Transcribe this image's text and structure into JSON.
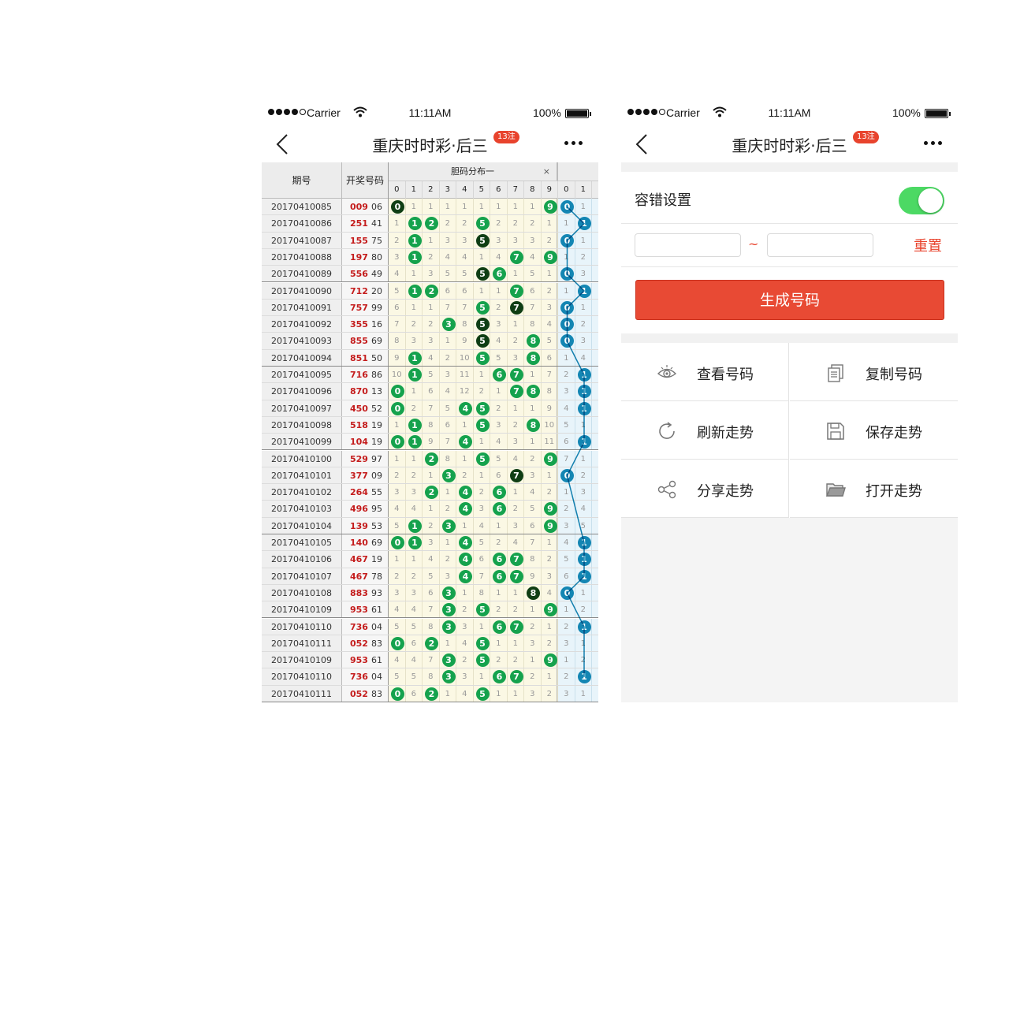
{
  "status_bar": {
    "carrier": "Carrier",
    "time": "11:11AM",
    "battery": "100%"
  },
  "nav": {
    "title": "重庆时时彩·后三",
    "badge": "13注"
  },
  "table": {
    "col_issue": "期号",
    "col_draw": "开奖号码",
    "group_title": "胆码分布一",
    "group_close": "×",
    "digits": [
      "0",
      "1",
      "2",
      "3",
      "4",
      "5",
      "6",
      "7",
      "8",
      "9"
    ],
    "digits2": [
      "0",
      "1"
    ],
    "rows": [
      {
        "issue": "20170410085",
        "main": "009",
        "tail": "06",
        "cells": [
          [
            "0",
            "d"
          ],
          "1",
          "1",
          "1",
          "1",
          "1",
          "1",
          "1",
          "1",
          [
            "9",
            "g"
          ]
        ],
        "c2": [
          [
            "0",
            "b"
          ],
          "1"
        ]
      },
      {
        "issue": "20170410086",
        "main": "251",
        "tail": "41",
        "cells": [
          "1",
          [
            "1",
            "g"
          ],
          [
            "2",
            "g"
          ],
          "2",
          "2",
          [
            "5",
            "g"
          ],
          "2",
          "2",
          "2",
          "1"
        ],
        "c2": [
          "1",
          [
            "1",
            "b"
          ]
        ]
      },
      {
        "issue": "20170410087",
        "main": "155",
        "tail": "75",
        "cells": [
          "2",
          [
            "1",
            "g"
          ],
          "1",
          "3",
          "3",
          [
            "5",
            "d"
          ],
          "3",
          "3",
          "3",
          "2"
        ],
        "c2": [
          [
            "0",
            "b"
          ],
          "1"
        ]
      },
      {
        "issue": "20170410088",
        "main": "197",
        "tail": "80",
        "cells": [
          "3",
          [
            "1",
            "g"
          ],
          "2",
          "4",
          "4",
          "1",
          "4",
          [
            "7",
            "g"
          ],
          "4",
          [
            "9",
            "g"
          ]
        ],
        "c2": [
          "1",
          "2"
        ]
      },
      {
        "issue": "20170410089",
        "main": "556",
        "tail": "49",
        "cells": [
          "4",
          "1",
          "3",
          "5",
          "5",
          [
            "5",
            "d"
          ],
          [
            "6",
            "g"
          ],
          "1",
          "5",
          "1"
        ],
        "c2": [
          [
            "0",
            "b"
          ],
          "3"
        ]
      },
      {
        "issue": "20170410090",
        "main": "712",
        "tail": "20",
        "cells": [
          "5",
          [
            "1",
            "g"
          ],
          [
            "2",
            "g"
          ],
          "6",
          "6",
          "1",
          "1",
          [
            "7",
            "g"
          ],
          "6",
          "2"
        ],
        "c2": [
          "1",
          [
            "1",
            "b"
          ]
        ]
      },
      {
        "issue": "20170410091",
        "main": "757",
        "tail": "99",
        "cells": [
          "6",
          "1",
          "1",
          "7",
          "7",
          [
            "5",
            "g"
          ],
          "2",
          [
            "7",
            "d"
          ],
          "7",
          "3"
        ],
        "c2": [
          [
            "0",
            "b"
          ],
          "1"
        ]
      },
      {
        "issue": "20170410092",
        "main": "355",
        "tail": "16",
        "cells": [
          "7",
          "2",
          "2",
          [
            "3",
            "g"
          ],
          "8",
          [
            "5",
            "d"
          ],
          "3",
          "1",
          "8",
          "4"
        ],
        "c2": [
          [
            "0",
            "b"
          ],
          "2"
        ]
      },
      {
        "issue": "20170410093",
        "main": "855",
        "tail": "69",
        "cells": [
          "8",
          "3",
          "3",
          "1",
          "9",
          [
            "5",
            "d"
          ],
          "4",
          "2",
          [
            "8",
            "g"
          ],
          "5"
        ],
        "c2": [
          [
            "0",
            "b"
          ],
          "3"
        ]
      },
      {
        "issue": "20170410094",
        "main": "851",
        "tail": "50",
        "cells": [
          "9",
          [
            "1",
            "g"
          ],
          "4",
          "2",
          "10",
          [
            "5",
            "g"
          ],
          "5",
          "3",
          [
            "8",
            "g"
          ],
          "6"
        ],
        "c2": [
          "1",
          "4"
        ]
      },
      {
        "issue": "20170410095",
        "main": "716",
        "tail": "86",
        "cells": [
          "10",
          [
            "1",
            "g"
          ],
          "5",
          "3",
          "11",
          "1",
          [
            "6",
            "g"
          ],
          [
            "7",
            "g"
          ],
          "1",
          "7"
        ],
        "c2": [
          "2",
          [
            "1",
            "b"
          ]
        ]
      },
      {
        "issue": "20170410096",
        "main": "870",
        "tail": "13",
        "cells": [
          [
            "0",
            "g"
          ],
          "1",
          "6",
          "4",
          "12",
          "2",
          "1",
          [
            "7",
            "g"
          ],
          [
            "8",
            "g"
          ],
          "8"
        ],
        "c2": [
          "3",
          [
            "1",
            "b"
          ]
        ]
      },
      {
        "issue": "20170410097",
        "main": "450",
        "tail": "52",
        "cells": [
          [
            "0",
            "g"
          ],
          "2",
          "7",
          "5",
          [
            "4",
            "g"
          ],
          [
            "5",
            "g"
          ],
          "2",
          "1",
          "1",
          "9"
        ],
        "c2": [
          "4",
          [
            "1",
            "b"
          ]
        ]
      },
      {
        "issue": "20170410098",
        "main": "518",
        "tail": "19",
        "cells": [
          "1",
          [
            "1",
            "g"
          ],
          "8",
          "6",
          "1",
          [
            "5",
            "g"
          ],
          "3",
          "2",
          [
            "8",
            "g"
          ],
          "10"
        ],
        "c2": [
          "5",
          "1"
        ]
      },
      {
        "issue": "20170410099",
        "main": "104",
        "tail": "19",
        "cells": [
          [
            "0",
            "g"
          ],
          [
            "1",
            "g"
          ],
          "9",
          "7",
          [
            "4",
            "g"
          ],
          "1",
          "4",
          "3",
          "1",
          "11"
        ],
        "c2": [
          "6",
          [
            "1",
            "b"
          ]
        ]
      },
      {
        "issue": "20170410100",
        "main": "529",
        "tail": "97",
        "cells": [
          "1",
          "1",
          [
            "2",
            "g"
          ],
          "8",
          "1",
          [
            "5",
            "g"
          ],
          "5",
          "4",
          "2",
          [
            "9",
            "g"
          ]
        ],
        "c2": [
          "7",
          "1"
        ]
      },
      {
        "issue": "20170410101",
        "main": "377",
        "tail": "09",
        "cells": [
          "2",
          "2",
          "1",
          [
            "3",
            "g"
          ],
          "2",
          "1",
          "6",
          [
            "7",
            "d"
          ],
          "3",
          "1"
        ],
        "c2": [
          [
            "0",
            "b"
          ],
          "2"
        ]
      },
      {
        "issue": "20170410102",
        "main": "264",
        "tail": "55",
        "cells": [
          "3",
          "3",
          [
            "2",
            "g"
          ],
          "1",
          [
            "4",
            "g"
          ],
          "2",
          [
            "6",
            "g"
          ],
          "1",
          "4",
          "2"
        ],
        "c2": [
          "1",
          "3"
        ]
      },
      {
        "issue": "20170410103",
        "main": "496",
        "tail": "95",
        "cells": [
          "4",
          "4",
          "1",
          "2",
          [
            "4",
            "g"
          ],
          "3",
          [
            "6",
            "g"
          ],
          "2",
          "5",
          [
            "9",
            "g"
          ]
        ],
        "c2": [
          "2",
          "4"
        ]
      },
      {
        "issue": "20170410104",
        "main": "139",
        "tail": "53",
        "cells": [
          "5",
          [
            "1",
            "g"
          ],
          "2",
          [
            "3",
            "g"
          ],
          "1",
          "4",
          "1",
          "3",
          "6",
          [
            "9",
            "g"
          ]
        ],
        "c2": [
          "3",
          "5"
        ]
      },
      {
        "issue": "20170410105",
        "main": "140",
        "tail": "69",
        "cells": [
          [
            "0",
            "g"
          ],
          [
            "1",
            "g"
          ],
          "3",
          "1",
          [
            "4",
            "g"
          ],
          "5",
          "2",
          "4",
          "7",
          "1"
        ],
        "c2": [
          "4",
          [
            "1",
            "b"
          ]
        ]
      },
      {
        "issue": "20170410106",
        "main": "467",
        "tail": "19",
        "cells": [
          "1",
          "1",
          "4",
          "2",
          [
            "4",
            "g"
          ],
          "6",
          [
            "6",
            "g"
          ],
          [
            "7",
            "g"
          ],
          "8",
          "2"
        ],
        "c2": [
          "5",
          [
            "1",
            "b"
          ]
        ]
      },
      {
        "issue": "20170410107",
        "main": "467",
        "tail": "78",
        "cells": [
          "2",
          "2",
          "5",
          "3",
          [
            "4",
            "g"
          ],
          "7",
          [
            "6",
            "g"
          ],
          [
            "7",
            "g"
          ],
          "9",
          "3"
        ],
        "c2": [
          "6",
          [
            "1",
            "b"
          ]
        ]
      },
      {
        "issue": "20170410108",
        "main": "883",
        "tail": "93",
        "cells": [
          "3",
          "3",
          "6",
          [
            "3",
            "g"
          ],
          "1",
          "8",
          "1",
          "1",
          [
            "8",
            "d"
          ],
          "4"
        ],
        "c2": [
          [
            "0",
            "b"
          ],
          "1"
        ]
      },
      {
        "issue": "20170410109",
        "main": "953",
        "tail": "61",
        "cells": [
          "4",
          "4",
          "7",
          [
            "3",
            "g"
          ],
          "2",
          [
            "5",
            "g"
          ],
          "2",
          "2",
          "1",
          [
            "9",
            "g"
          ]
        ],
        "c2": [
          "1",
          "2"
        ]
      },
      {
        "issue": "20170410110",
        "main": "736",
        "tail": "04",
        "cells": [
          "5",
          "5",
          "8",
          [
            "3",
            "g"
          ],
          "3",
          "1",
          [
            "6",
            "g"
          ],
          [
            "7",
            "g"
          ],
          "2",
          "1"
        ],
        "c2": [
          "2",
          [
            "1",
            "b"
          ]
        ]
      },
      {
        "issue": "20170410111",
        "main": "052",
        "tail": "83",
        "cells": [
          [
            "0",
            "g"
          ],
          "6",
          [
            "2",
            "g"
          ],
          "1",
          "4",
          [
            "5",
            "g"
          ],
          "1",
          "1",
          "3",
          "2"
        ],
        "c2": [
          "3",
          "1"
        ]
      },
      {
        "issue": "20170410109",
        "main": "953",
        "tail": "61",
        "cells": [
          "4",
          "4",
          "7",
          [
            "3",
            "g"
          ],
          "2",
          [
            "5",
            "g"
          ],
          "2",
          "2",
          "1",
          [
            "9",
            "g"
          ]
        ],
        "c2": [
          "1",
          "2"
        ]
      },
      {
        "issue": "20170410110",
        "main": "736",
        "tail": "04",
        "cells": [
          "5",
          "5",
          "8",
          [
            "3",
            "g"
          ],
          "3",
          "1",
          [
            "6",
            "g"
          ],
          [
            "7",
            "g"
          ],
          "2",
          "1"
        ],
        "c2": [
          "2",
          [
            "1",
            "b"
          ]
        ]
      },
      {
        "issue": "20170410111",
        "main": "052",
        "tail": "83",
        "cells": [
          [
            "0",
            "g"
          ],
          "6",
          [
            "2",
            "g"
          ],
          "1",
          "4",
          [
            "5",
            "g"
          ],
          "1",
          "1",
          "3",
          "2"
        ],
        "c2": [
          "3",
          "1"
        ]
      }
    ]
  },
  "settings": {
    "tolerance_label": "容错设置",
    "tolerance_enabled": true,
    "range_from": "",
    "range_to": "",
    "range_separator": "~",
    "reset_label": "重置",
    "generate_label": "生成号码"
  },
  "actions": [
    {
      "label": "查看号码",
      "icon": "eye-icon"
    },
    {
      "label": "复制号码",
      "icon": "copy-icon"
    },
    {
      "label": "刷新走势",
      "icon": "refresh-icon"
    },
    {
      "label": "保存走势",
      "icon": "save-icon"
    },
    {
      "label": "分享走势",
      "icon": "share-icon"
    },
    {
      "label": "打开走势",
      "icon": "folder-open-icon"
    }
  ],
  "colors": {
    "accent_red": "#e84a34",
    "toggle_green": "#4cd964",
    "ball_green": "#15a24d",
    "ball_dark": "#0f3e14",
    "ball_blue": "#1386b3",
    "draw_red": "#c41c1c"
  }
}
